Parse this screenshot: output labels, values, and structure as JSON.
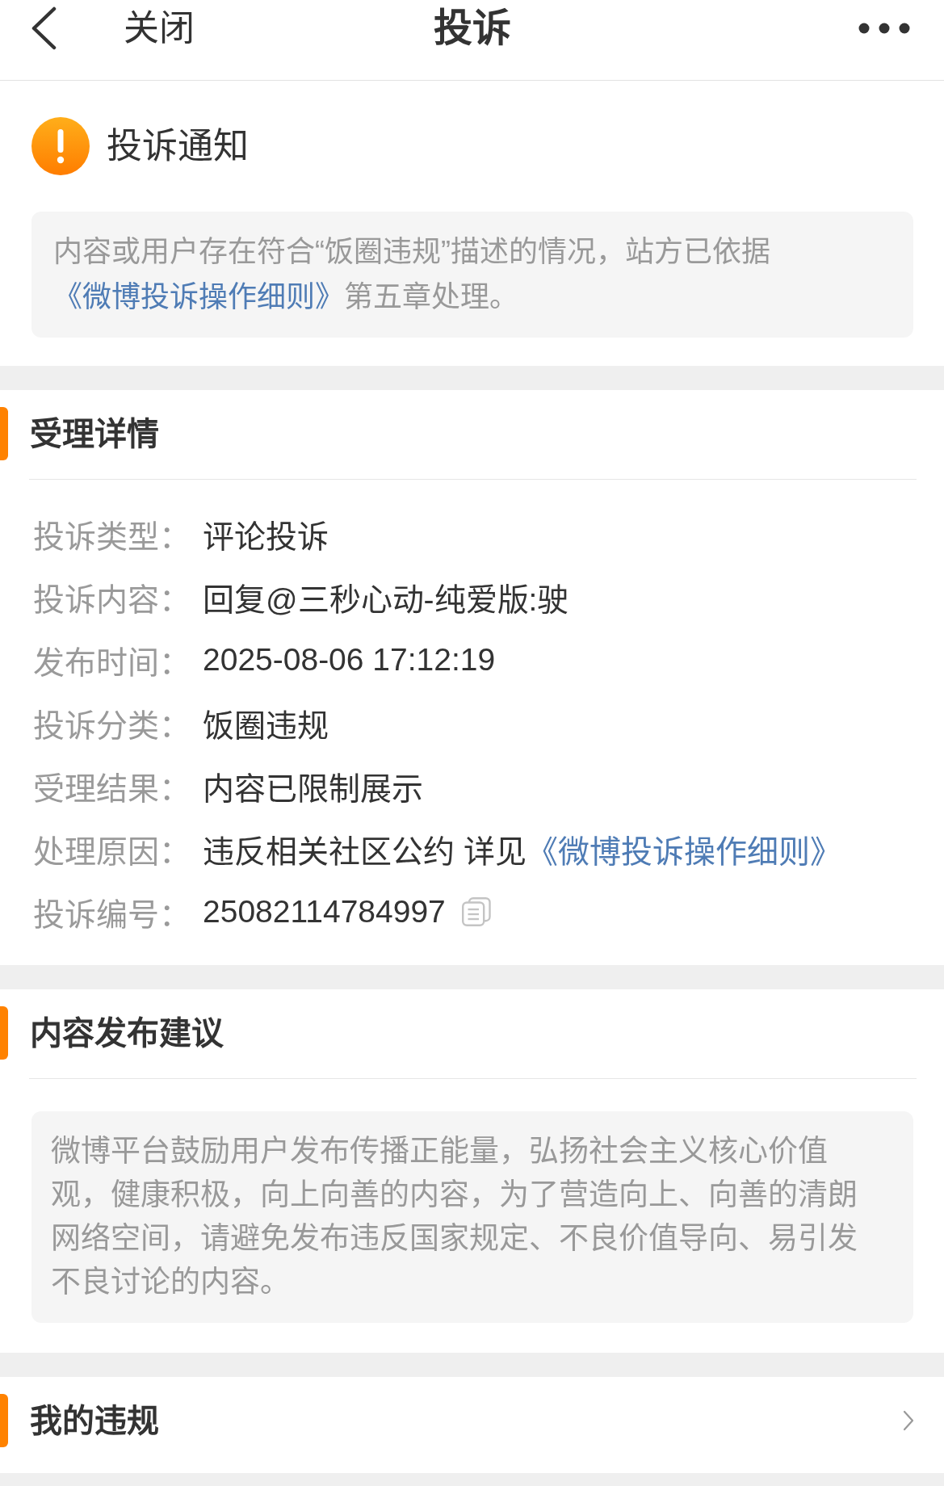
{
  "top_bar": {
    "close_label": "关闭",
    "title": "投诉"
  },
  "notice": {
    "title": "投诉通知",
    "message": [
      {
        "kind": "text",
        "text": "内容或用户存在符合“饭圈违规”描述的情况，站方已依据"
      },
      {
        "kind": "link",
        "text": "《微博投诉操作细则》"
      },
      {
        "kind": "text",
        "text": "第五章处理。"
      }
    ]
  },
  "details": {
    "title": "受理详情",
    "rows": [
      {
        "kind": "text",
        "label": "投诉类型：",
        "value": "评论投诉"
      },
      {
        "kind": "text",
        "label": "投诉内容：",
        "value": "回复@三秒心动-纯爱版:驶"
      },
      {
        "kind": "text",
        "label": "发布时间：",
        "value": "2025-08-06 17:12:19"
      },
      {
        "kind": "text",
        "label": "投诉分类：",
        "value": "饭圈违规"
      },
      {
        "kind": "text",
        "label": "受理结果：",
        "value": "内容已限制展示"
      },
      {
        "kind": "link",
        "label": "处理原因：",
        "value": "违反相关社区公约 详见",
        "link": "《微博投诉操作细则》"
      },
      {
        "kind": "copy",
        "label": "投诉编号：",
        "value": "25082114784997"
      }
    ]
  },
  "advice": {
    "title": "内容发布建议",
    "text": "微博平台鼓励用户发布传播正能量，弘扬社会主义核心价值观，健康积极，向上向善的内容，为了营造向上、向善的清朗网络空间，请避免发布违反国家规定、不良价值导向、易引发不良讨论的内容。"
  },
  "violations": {
    "title": "我的违规"
  }
}
